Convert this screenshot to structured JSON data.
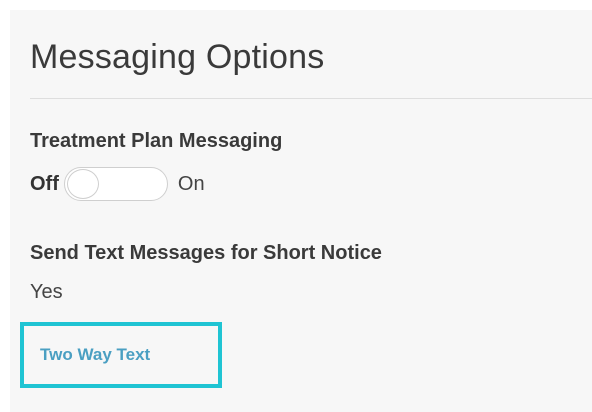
{
  "section": {
    "title": "Messaging Options"
  },
  "treatment_plan": {
    "label": "Treatment Plan Messaging",
    "toggle": {
      "off_label": "Off",
      "on_label": "On",
      "state": "off"
    }
  },
  "short_notice": {
    "label": "Send Text Messages for Short Notice",
    "value": "Yes"
  },
  "two_way_text": {
    "link_label": "Two Way Text",
    "highlight_color": "#1fc4d3",
    "link_color": "#4a9fc2"
  }
}
